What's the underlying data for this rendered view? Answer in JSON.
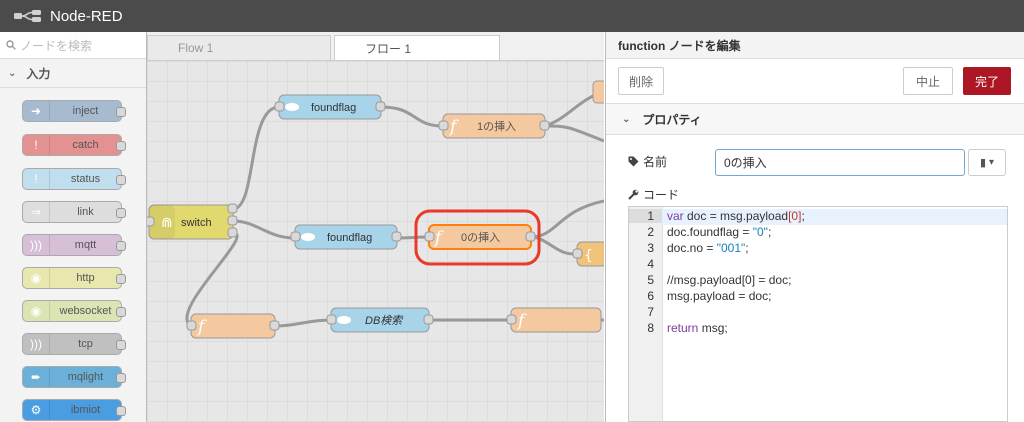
{
  "app": {
    "title": "Node-RED",
    "colors": {
      "header_bg": "#4b4b4b",
      "primary": "#ad1625",
      "highlight": "#e8392a"
    }
  },
  "palette": {
    "search_placeholder": "ノードを検索",
    "category": "入力",
    "nodes": [
      {
        "label": "inject",
        "color": "#a6bbcf",
        "icon": "arrow-icon"
      },
      {
        "label": "catch",
        "color": "#e49191",
        "icon": "exclamation-icon"
      },
      {
        "label": "status",
        "color": "#c0deed",
        "icon": "exclamation-icon"
      },
      {
        "label": "link",
        "color": "#dddddd",
        "icon": "link-icon"
      },
      {
        "label": "mqtt",
        "color": "#d8bfd8",
        "icon": "signal-icon"
      },
      {
        "label": "http",
        "color": "#e7e7ae",
        "icon": "globe-icon"
      },
      {
        "label": "websocket",
        "color": "#dbe5b4",
        "icon": "globe-icon"
      },
      {
        "label": "tcp",
        "color": "#c0c0c0",
        "icon": "signal-icon"
      },
      {
        "label": "mqlight",
        "color": "#6bb0d9",
        "icon": "mqlight-icon"
      },
      {
        "label": "ibmiot",
        "color": "#4a9de0",
        "icon": "iot-icon"
      }
    ]
  },
  "workspace": {
    "tabs": [
      {
        "label": "Flow 1",
        "active": false
      },
      {
        "label": "フロー 1",
        "active": true
      }
    ],
    "nodes": [
      {
        "id": "switch",
        "label": "switch",
        "color": "#e2d96e"
      },
      {
        "id": "foundflag1",
        "label": "foundflag",
        "color": "#a8d4ea"
      },
      {
        "id": "insert1",
        "label": "1の挿入",
        "color": "#f5c9a0"
      },
      {
        "id": "foundflag2",
        "label": "foundflag",
        "color": "#a8d4ea"
      },
      {
        "id": "insert0",
        "label": "0の挿入",
        "color": "#f5c9a0"
      },
      {
        "id": "func-blank",
        "label": "",
        "color": "#f5c9a0"
      },
      {
        "id": "dbsearch",
        "label": "DB検索",
        "color": "#a8d4ea"
      },
      {
        "id": "func-right",
        "label": "",
        "color": "#f5c9a0"
      },
      {
        "id": "json",
        "label": "",
        "color": "#f0c27a"
      },
      {
        "id": "func-top",
        "label": "",
        "color": "#f5c9a0"
      }
    ]
  },
  "tray": {
    "title": "function ノードを編集",
    "delete_label": "削除",
    "cancel_label": "中止",
    "done_label": "完了",
    "section_title": "プロパティ",
    "name_label": "名前",
    "name_value": "0の挿入",
    "code_label": "コード",
    "code_lines": [
      "var doc = msg.payload[0];",
      "doc.foundflag = \"0\";",
      "doc.no = \"001\";",
      "",
      "//msg.payload[0] = doc;",
      "msg.payload = doc;",
      "",
      "return msg;"
    ]
  }
}
